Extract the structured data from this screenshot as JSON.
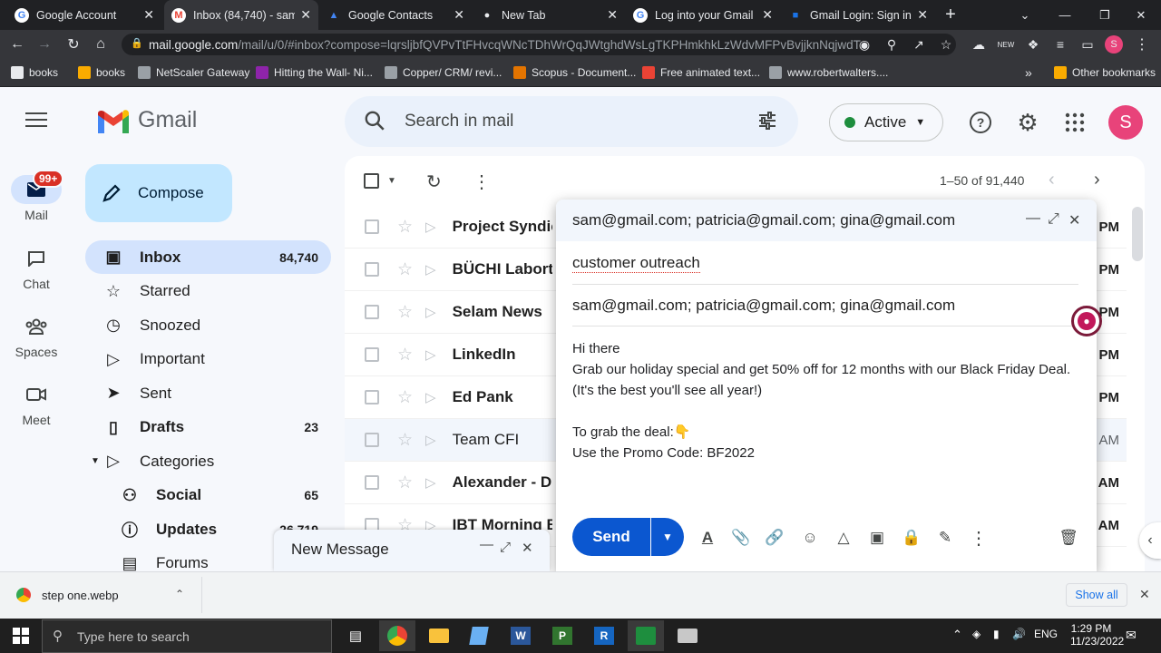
{
  "browser": {
    "tabs": [
      {
        "title": "Google Account",
        "fav": "G",
        "favcolor": "#4285f4",
        "favbg": "#fff"
      },
      {
        "title": "Inbox (84,740) - sams",
        "fav": "M",
        "favcolor": "#ea4335",
        "favbg": "#fff",
        "active": true
      },
      {
        "title": "Google Contacts",
        "fav": "▲",
        "favcolor": "#4285f4",
        "favbg": "transparent"
      },
      {
        "title": "New Tab",
        "fav": "●",
        "favcolor": "#e8eaed",
        "favbg": "transparent"
      },
      {
        "title": "Log into your Gmail a",
        "fav": "G",
        "favcolor": "#4285f4",
        "favbg": "#fff"
      },
      {
        "title": "Gmail Login: Sign in t",
        "fav": "■",
        "favcolor": "#1a73e8",
        "favbg": "transparent"
      }
    ],
    "url_domain": "mail.google.com",
    "url_rest": "/mail/u/0/#inbox?compose=lqrsljbfQVPvTtFHvcqWNcTDhWrQqJWtghdWsLgTKPHmkhkLzWdvMFPvBvjjknNqjwdT...",
    "bookmarks": [
      {
        "label": "books",
        "color": "#e8eaed"
      },
      {
        "label": "books",
        "color": "#f9ab00"
      },
      {
        "label": "NetScaler Gateway",
        "color": "#9aa0a6"
      },
      {
        "label": "Hitting the Wall- Ni...",
        "color": "#8e24aa"
      },
      {
        "label": "Copper/ CRM/ revi...",
        "color": "#9aa0a6"
      },
      {
        "label": "Scopus - Document...",
        "color": "#e37400"
      },
      {
        "label": "Free animated text...",
        "color": "#ea4335"
      },
      {
        "label": "www.robertwalters....",
        "color": "#9aa0a6"
      }
    ],
    "bookmarks_more": "»",
    "other_bookmarks": "Other bookmarks",
    "profile_letter": "S"
  },
  "gmail": {
    "logo_text": "Gmail",
    "search_placeholder": "Search in mail",
    "status": "Active",
    "avatar_letter": "S",
    "rail": [
      {
        "label": "Mail",
        "badge": "99+"
      },
      {
        "label": "Chat"
      },
      {
        "label": "Spaces"
      },
      {
        "label": "Meet"
      }
    ],
    "compose_label": "Compose",
    "nav": [
      {
        "label": "Inbox",
        "count": "84,740",
        "icon": "inbox-icon",
        "selected": true
      },
      {
        "label": "Starred",
        "count": "",
        "icon": "star-icon"
      },
      {
        "label": "Snoozed",
        "count": "",
        "icon": "clock-icon"
      },
      {
        "label": "Important",
        "count": "",
        "icon": "important-icon"
      },
      {
        "label": "Sent",
        "count": "",
        "icon": "send-icon"
      },
      {
        "label": "Drafts",
        "count": "23",
        "icon": "draft-icon",
        "bold": true
      },
      {
        "label": "Categories",
        "count": "",
        "icon": "label-icon"
      },
      {
        "label": "Social",
        "count": "65",
        "icon": "people-icon",
        "bold": true
      },
      {
        "label": "Updates",
        "count": "26,719",
        "icon": "info-icon",
        "bold": true
      },
      {
        "label": "Forums",
        "count": "",
        "icon": "forum-icon"
      }
    ],
    "pagination": "1–50 of 91,440",
    "rows": [
      {
        "sender": "Project Syndic",
        "bold": true,
        "time": "PM"
      },
      {
        "sender": "BÜCHI Labort",
        "bold": true,
        "time": "PM"
      },
      {
        "sender": "Selam News",
        "bold": true,
        "time": "PM"
      },
      {
        "sender": "LinkedIn",
        "bold": true,
        "time": "PM"
      },
      {
        "sender": "Ed Pank",
        "bold": true,
        "time": "PM"
      },
      {
        "sender": "Team CFI",
        "bold": false,
        "time": "AM"
      },
      {
        "sender": "Alexander - D",
        "bold": true,
        "time": "AM"
      },
      {
        "sender": "IBT Morning B",
        "bold": true,
        "time": "AM"
      }
    ]
  },
  "compose": {
    "title": "sam@gmail.com; patricia@gmail.com; gina@gmail.com",
    "subject": "customer outreach",
    "to": "sam@gmail.com; patricia@gmail.com; gina@gmail.com",
    "body": [
      "Hi there",
      "Grab our holiday special and get 50% off for 12 months with our Black Friday Deal.",
      "(It's the best you'll see all year!)",
      "",
      "To grab the deal:👇",
      "Use the Promo Code: BF2022"
    ],
    "send_label": "Send"
  },
  "minimized": {
    "title": "New Message"
  },
  "downloads": {
    "file": "step one.webp",
    "show_all": "Show all"
  },
  "taskbar": {
    "search_placeholder": "Type here to search",
    "lang": "ENG",
    "time": "1:29 PM",
    "date": "11/23/2022"
  }
}
